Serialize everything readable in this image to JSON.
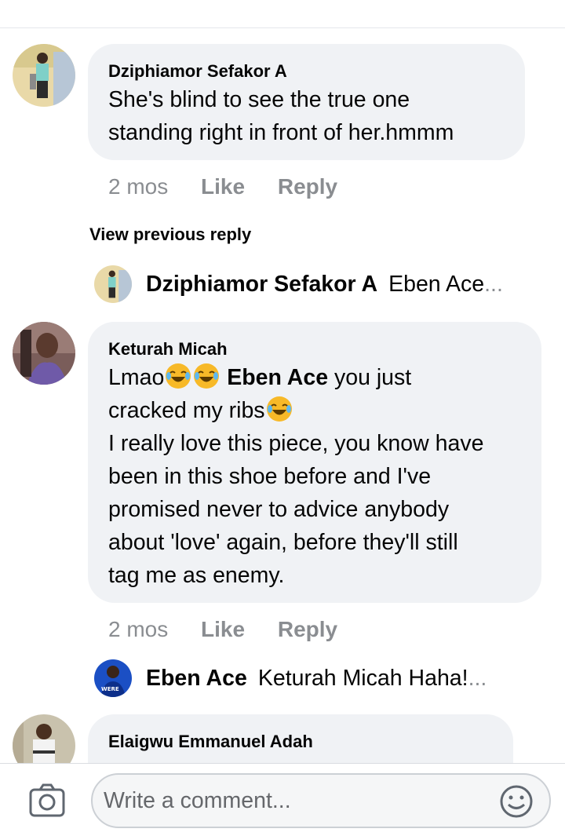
{
  "comments": [
    {
      "author": "Dziphiamor Sefakor A",
      "lines": [
        "She's blind to see the true one",
        "standing right in front of her.hmmm"
      ],
      "time": "2 mos",
      "like_label": "Like",
      "reply_label": "Reply"
    },
    {
      "author": "Keturah Micah",
      "line1_pre": "Lmao",
      "mention": "Eben Ace",
      "line1_post": " you just",
      "line2": "cracked my ribs",
      "lines": [
        "I really love this piece, you know have",
        "been in this shoe before and I've",
        "promised never to advice anybody",
        "about 'love' again, before they'll still",
        "tag me as enemy."
      ],
      "time": "2 mos",
      "like_label": "Like",
      "reply_label": "Reply"
    },
    {
      "author": "Elaigwu Emmanuel Adah"
    }
  ],
  "view_previous_reply": "View previous reply",
  "replies": [
    {
      "author": "Dziphiamor Sefakor A",
      "text": "Eben Ace",
      "ellipsis": "..."
    },
    {
      "author": "Eben Ace",
      "text": "Keturah Micah Haha!",
      "ellipsis": "...",
      "avatar_badge": "WERE"
    }
  ],
  "composer": {
    "placeholder": "Write a comment...",
    "camera_icon": "camera-icon",
    "emoji_icon": "smiley-icon"
  },
  "colors": {
    "bubble": "#f0f2f5",
    "meta_text": "#8a8d91",
    "text": "#050505"
  }
}
